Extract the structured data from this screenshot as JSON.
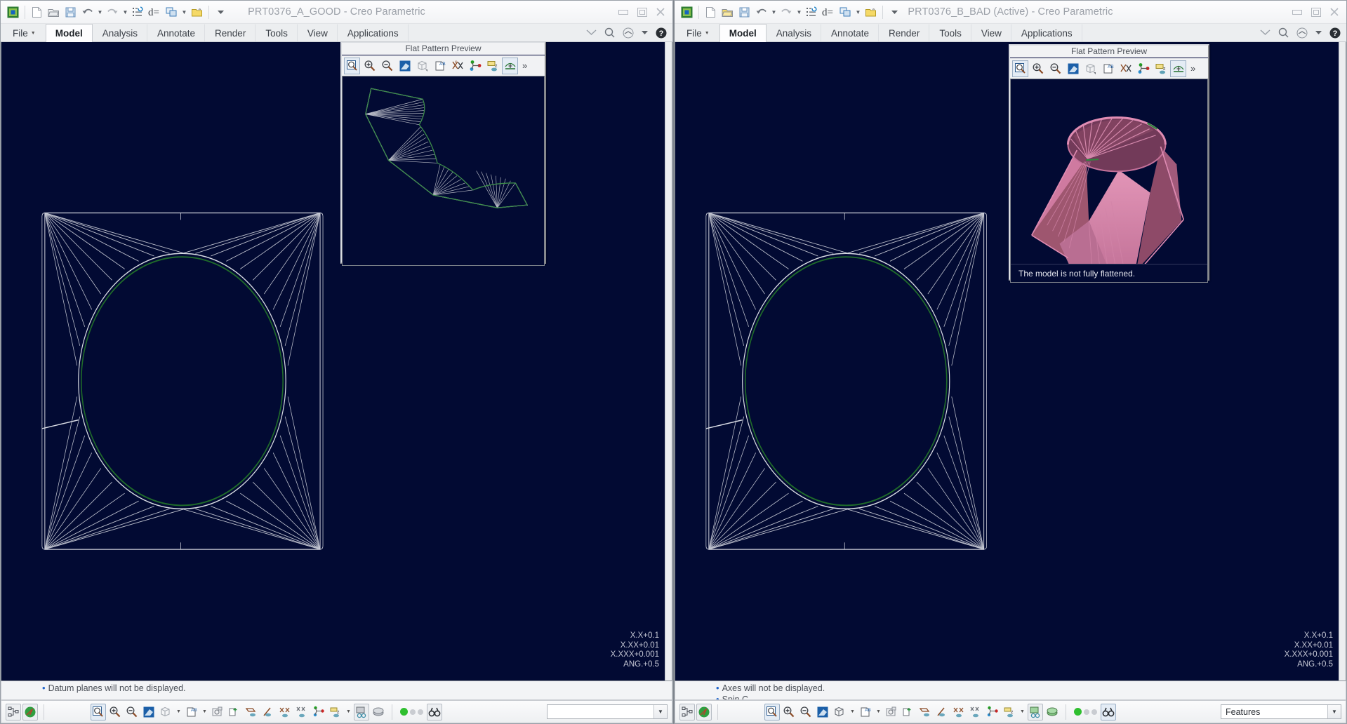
{
  "windows": [
    {
      "id": "left",
      "title": "PRT0376_A_GOOD - Creo Parametric",
      "tabs": [
        {
          "label": "File",
          "active": false,
          "is_file": true
        },
        {
          "label": "Model",
          "active": true
        },
        {
          "label": "Analysis",
          "active": false
        },
        {
          "label": "Annotate",
          "active": false
        },
        {
          "label": "Render",
          "active": false
        },
        {
          "label": "Tools",
          "active": false
        },
        {
          "label": "View",
          "active": false
        },
        {
          "label": "Applications",
          "active": false
        }
      ],
      "window_controls": [
        "minimize",
        "maximize",
        "close"
      ],
      "quick_access": [
        "creo-logo-icon",
        "new-icon",
        "open-icon",
        "save-icon",
        "undo-icon",
        "redo-icon",
        "regenerate-icon",
        "parameters-icon",
        "window-switch-icon",
        "open-folder-icon",
        "customize-icon"
      ],
      "ribbon_right_icons": [
        "collapse-ribbon-icon",
        "search-icon",
        "help-center-icon",
        "help-icon"
      ],
      "viewport": {
        "tolerance": "X.X+0.1\nX.XX+0.01\nX.XXX+0.001\nANG.+0.5",
        "background_color": "#020a33"
      },
      "flat_pattern_preview": {
        "title": "Flat Pattern Preview",
        "toolbar_icons": [
          "refit-icon",
          "zoom-in-icon",
          "zoom-out-icon",
          "repaint-icon",
          "view-orientation-icon",
          "annotation-display-icon",
          "datum-display-icon",
          "axis-display-icon",
          "csys-display-icon",
          "plane-display-icon"
        ],
        "overflow_label": "»",
        "message": "",
        "show_message": false,
        "content": "flat-pattern-unfolded"
      },
      "message_area": {
        "lines": [
          "Datum planes will not be displayed."
        ]
      },
      "status_bar": {
        "left_icons": [
          "model-tree-icon",
          "navigator-icon"
        ],
        "tool_icons": [
          "refit-icon",
          "zoom-in-icon",
          "zoom-out-icon",
          "repaint-icon",
          "display-style-icon",
          "annotation-display-icon",
          "saved-view-icon",
          "view-manager-icon",
          "plane-display-icon",
          "axis-display-icon",
          "point-display-icon",
          "csys-display-icon",
          "datum-display-icon",
          "spin-center-icon",
          "appearance-icon"
        ],
        "selection_dots": [
          "active",
          "inactive",
          "inactive"
        ],
        "find_icon": "find-icon",
        "select_value": "",
        "select_placeholder": ""
      }
    },
    {
      "id": "right",
      "title": "PRT0376_B_BAD (Active) - Creo Parametric",
      "tabs": [
        {
          "label": "File",
          "active": false,
          "is_file": true
        },
        {
          "label": "Model",
          "active": true
        },
        {
          "label": "Analysis",
          "active": false
        },
        {
          "label": "Annotate",
          "active": false
        },
        {
          "label": "Render",
          "active": false
        },
        {
          "label": "Tools",
          "active": false
        },
        {
          "label": "View",
          "active": false
        },
        {
          "label": "Applications",
          "active": false
        }
      ],
      "window_controls": [
        "minimize",
        "maximize",
        "close"
      ],
      "quick_access": [
        "creo-logo-icon",
        "new-icon",
        "open-icon",
        "save-icon",
        "undo-icon",
        "redo-icon",
        "regenerate-icon",
        "parameters-icon",
        "window-switch-icon",
        "open-folder-icon",
        "customize-icon"
      ],
      "ribbon_right_icons": [
        "collapse-ribbon-icon",
        "search-icon",
        "help-center-icon",
        "help-icon"
      ],
      "viewport": {
        "tolerance": "X.X+0.1\nX.XX+0.01\nX.XXX+0.001\nANG.+0.5",
        "background_color": "#020a33"
      },
      "flat_pattern_preview": {
        "title": "Flat Pattern Preview",
        "toolbar_icons": [
          "refit-icon",
          "zoom-in-icon",
          "zoom-out-icon",
          "repaint-icon",
          "view-orientation-icon",
          "annotation-display-icon",
          "datum-display-icon",
          "axis-display-icon",
          "csys-display-icon",
          "plane-display-icon"
        ],
        "overflow_label": "»",
        "message": "The model is not fully flattened.",
        "show_message": true,
        "content": "solid-cone-not-flattened"
      },
      "message_area": {
        "lines": [
          "Axes will not be displayed.",
          "Spin C"
        ]
      },
      "status_bar": {
        "left_icons": [
          "model-tree-icon",
          "navigator-icon"
        ],
        "tool_icons": [
          "refit-icon",
          "zoom-in-icon",
          "zoom-out-icon",
          "repaint-icon",
          "display-style-icon",
          "annotation-display-icon",
          "saved-view-icon",
          "view-manager-icon",
          "plane-display-icon",
          "axis-display-icon",
          "point-display-icon",
          "csys-display-icon",
          "datum-display-icon",
          "spin-center-icon",
          "appearance-icon"
        ],
        "selection_dots": [
          "active",
          "inactive",
          "inactive"
        ],
        "find_icon": "find-icon",
        "select_value": "Features",
        "select_placeholder": "Features"
      }
    }
  ],
  "colors": {
    "viewport_background": "#020a33",
    "wireframe_line": "#d9dbe4",
    "wireframe_edge_green": "#1f6b2a",
    "solid_pink": "#d77ba4",
    "solid_pink_dark": "#8e4a68",
    "chrome": "#f3f4f6",
    "accent_blue": "#2266cc"
  }
}
